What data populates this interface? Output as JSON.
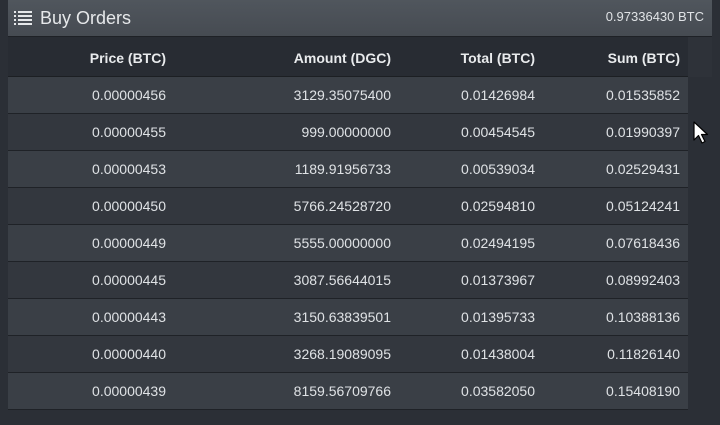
{
  "panel": {
    "title": "Buy Orders",
    "total": "0.97336430 BTC",
    "title_icon": "list-icon"
  },
  "table": {
    "headers": {
      "price": "Price (BTC)",
      "amount": "Amount (DGC)",
      "total": "Total (BTC)",
      "sum": "Sum (BTC)"
    },
    "rows": [
      {
        "price": "0.00000456",
        "amount": "3129.35075400",
        "total": "0.01426984",
        "sum": "0.01535852"
      },
      {
        "price": "0.00000455",
        "amount": "999.00000000",
        "total": "0.00454545",
        "sum": "0.01990397"
      },
      {
        "price": "0.00000453",
        "amount": "1189.91956733",
        "total": "0.00539034",
        "sum": "0.02529431"
      },
      {
        "price": "0.00000450",
        "amount": "5766.24528720",
        "total": "0.02594810",
        "sum": "0.05124241"
      },
      {
        "price": "0.00000449",
        "amount": "5555.00000000",
        "total": "0.02494195",
        "sum": "0.07618436"
      },
      {
        "price": "0.00000445",
        "amount": "3087.56644015",
        "total": "0.01373967",
        "sum": "0.08992403"
      },
      {
        "price": "0.00000443",
        "amount": "3150.63839501",
        "total": "0.01395733",
        "sum": "0.10388136"
      },
      {
        "price": "0.00000440",
        "amount": "3268.19089095",
        "total": "0.01438004",
        "sum": "0.11826140"
      },
      {
        "price": "0.00000439",
        "amount": "8159.56709766",
        "total": "0.03582050",
        "sum": "0.15408190"
      }
    ]
  },
  "cursor": {
    "icon": "mouse-pointer-icon"
  }
}
